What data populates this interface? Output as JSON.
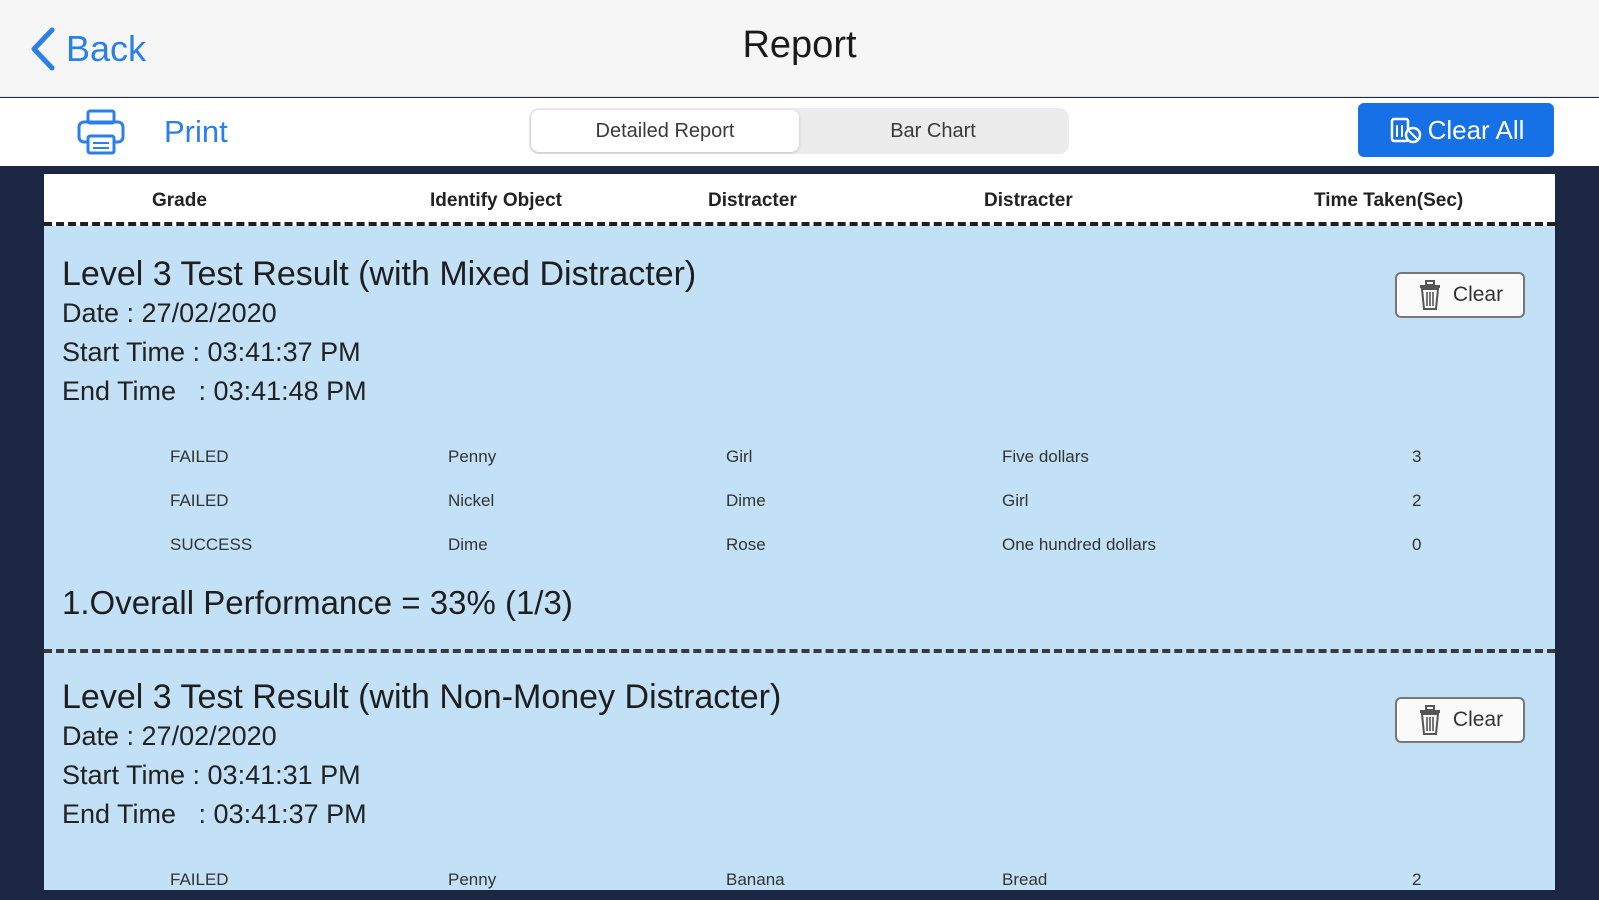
{
  "nav": {
    "back_label": "Back",
    "title": "Report"
  },
  "toolbar": {
    "print_label": "Print",
    "segments": [
      "Detailed Report",
      "Bar Chart"
    ],
    "active_segment": "Detailed Report",
    "clear_all_label": "Clear All"
  },
  "table": {
    "columns": [
      "Grade",
      "Identify Object",
      "Distracter",
      "Distracter",
      "Time Taken(Sec)"
    ]
  },
  "results": [
    {
      "title": "Level 3 Test Result (with Mixed Distracter)",
      "date": "Date : 27/02/2020",
      "start": "Start Time : 03:41:37 PM",
      "end": "End Time   : 03:41:48 PM",
      "clear_label": "Clear",
      "rows": [
        [
          "FAILED",
          "Penny",
          "Girl",
          "Five dollars",
          "3"
        ],
        [
          "FAILED",
          "Nickel",
          "Dime",
          "Girl",
          "2"
        ],
        [
          "SUCCESS",
          "Dime",
          "Rose",
          "One hundred dollars",
          "0"
        ]
      ],
      "overall": "1.Overall Performance = 33% (1/3)"
    },
    {
      "title": "Level 3 Test Result (with Non-Money Distracter)",
      "date": "Date : 27/02/2020",
      "start": "Start Time : 03:41:31 PM",
      "end": "End Time   : 03:41:37 PM",
      "clear_label": "Clear",
      "rows": [
        [
          "FAILED",
          "Penny",
          "Banana",
          "Bread",
          "2"
        ]
      ]
    }
  ],
  "colors": {
    "accent": "#1670e6",
    "link": "#2a7fe8",
    "panel_bg": "#c2e1f7",
    "page_bg": "#1c2843"
  },
  "icons": [
    "chevron-left-icon",
    "printer-icon",
    "trash-icon"
  ]
}
